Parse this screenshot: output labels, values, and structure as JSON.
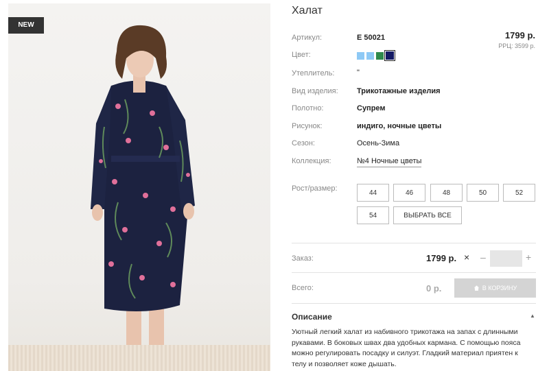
{
  "product": {
    "badge": "NEW",
    "title": "Халат",
    "price": "1799 р.",
    "rrp": "РРЦ: 3599 р."
  },
  "attributes": [
    {
      "label": "Артикул:",
      "value": "Е 50021"
    },
    {
      "label": "Цвет:",
      "value": ""
    },
    {
      "label": "Утеплитель:",
      "value": "\""
    },
    {
      "label": "Вид изделия:",
      "value": "Трикотажные изделия"
    },
    {
      "label": "Полотно:",
      "value": "Супрем"
    },
    {
      "label": "Рисунок:",
      "value": "индиго, ночные цветы"
    },
    {
      "label": "Сезон:",
      "value": "Осень-Зима"
    },
    {
      "label": "Коллекция:",
      "value": "№4 Ночные цветы"
    }
  ],
  "colors": [
    {
      "hex": "#8ec9f5",
      "selected": false
    },
    {
      "hex": "#8ec9f5",
      "selected": false
    },
    {
      "hex": "#2f8a4c",
      "selected": false
    },
    {
      "hex": "#141a64",
      "selected": true
    }
  ],
  "size": {
    "label": "Рост/размер:",
    "options": [
      "44",
      "46",
      "48",
      "50",
      "52",
      "54"
    ],
    "select_all": "ВЫБРАТЬ ВСЕ"
  },
  "order": {
    "label": "Заказ:",
    "price": "1799 р.",
    "times": "×",
    "minus": "–",
    "plus": "+",
    "quantity": ""
  },
  "total": {
    "label": "Всего:",
    "value": "0 р.",
    "cart_button": "В КОРЗИНУ"
  },
  "description": {
    "title": "Описание",
    "text": "Уютный легкий халат из набивного трикотажа на запах с длинными рукавами. В боковых швах два удобных кармана. С помощью пояса можно регулировать посадку и силуэт. Гладкий материал приятен к телу и позволяет коже дышать."
  }
}
